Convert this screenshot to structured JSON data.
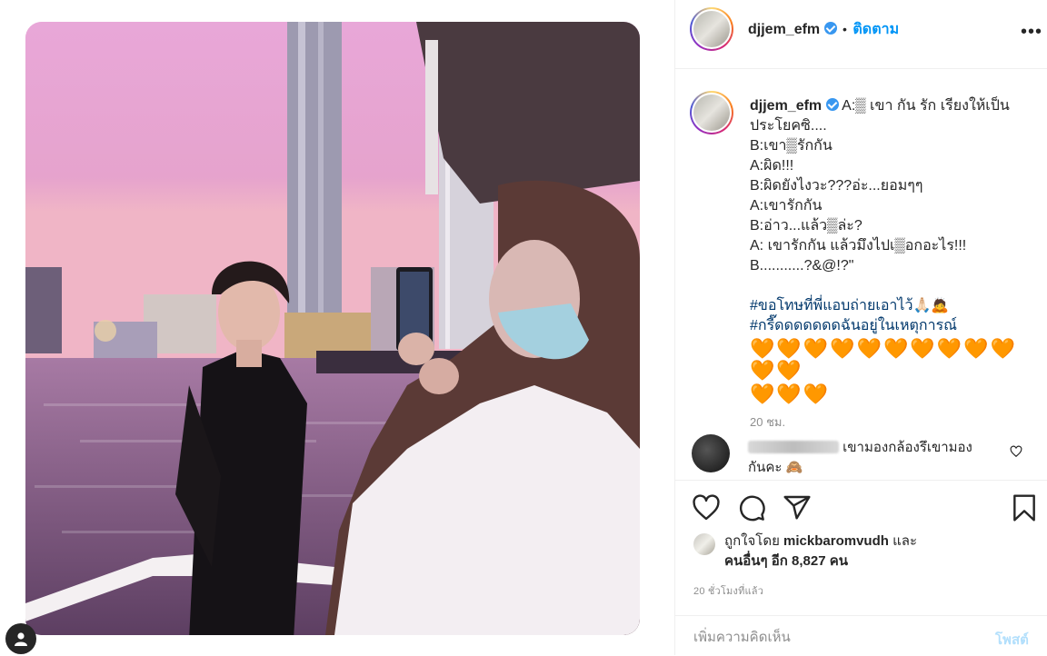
{
  "post": {
    "image_alt": "photo",
    "author": "djjem_efm",
    "follow_separator": "•",
    "follow_label": "ติดตาม",
    "more_icon": "more-horizontal-icon"
  },
  "caption": {
    "username": "djjem_efm",
    "lines": [
      "A:▒ เขา กัน รัก เรียงให้เป็น",
      "ประโยคซิ....",
      "B:เขา▒รักกัน",
      "A:ผิด!!!",
      "B:ผิดยังไงวะ???อ่ะ...ยอมๆๆ",
      "A:เขารักกัน",
      "B:อ่าว...แล้ว▒ล่ะ?",
      "A: เขารักกัน แล้วมึงไปเ▒อกอะไร!!!",
      "B...........?&@!?\""
    ],
    "hashtags": [
      "#ขอโทษที่พี่แอบถ่ายเอาไว้🙏🏻🙇",
      "#กรี๊ดดดดดดดฉันอยู่ในเหตุการณ์"
    ],
    "hearts_row1": "🧡🧡🧡🧡🧡🧡🧡🧡🧡🧡🧡🧡",
    "hearts_row2": "🧡🧡🧡",
    "time": "20 ชม."
  },
  "comment": {
    "text": "เขามองกล้องรึเขามอง",
    "text2": "กันคะ 🙈"
  },
  "actions": {
    "like_icon": "heart-icon",
    "comment_icon": "comment-icon",
    "share_icon": "share-icon",
    "save_icon": "bookmark-icon"
  },
  "likes": {
    "prefix": "ถูกใจโดย",
    "liker": "mickbaromvudh",
    "and": "และ",
    "others": "คนอื่นๆ อีก 8,827 คน"
  },
  "post_time": "20 ชั่วโมงที่แล้ว",
  "add_comment": {
    "placeholder": "เพิ่มความคิดเห็น",
    "post_label": "โพสต์"
  },
  "colors": {
    "accent": "#0095f6",
    "hashtag": "#00376b",
    "muted": "#8e8e8e"
  }
}
